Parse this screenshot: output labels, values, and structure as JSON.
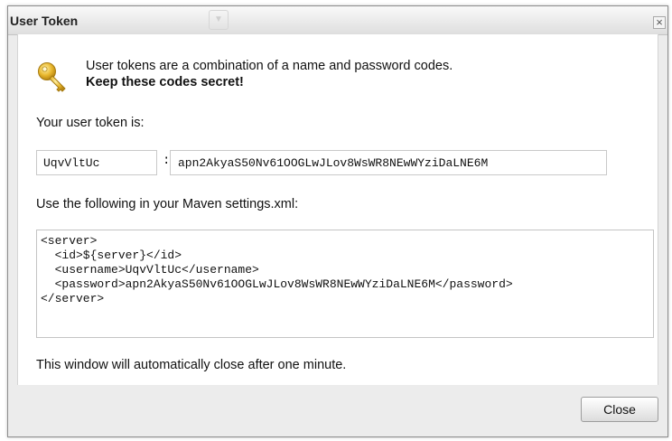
{
  "window": {
    "title": "User Token"
  },
  "intro": {
    "line1": "User tokens are a combination of a name and password codes.",
    "line2": "Keep these codes secret!"
  },
  "token_label": "Your user token is:",
  "token": {
    "name": "UqvVltUc",
    "separator": ":",
    "password": "apn2AkyaS50Nv61OOGLwJLov8WsWR8NEwWYziDaLNE6M"
  },
  "maven_label": "Use the following in your Maven settings.xml:",
  "xml_lines": [
    "<server>",
    "  <id>${server}</id>",
    "  <username>UqvVltUc</username>",
    "  <password>apn2AkyaS50Nv61OOGLwJLov8WsWR8NEwWYziDaLNE6M</password>",
    "</server>"
  ],
  "auto_close_text": "This window will automatically close after one minute.",
  "footer": {
    "close_label": "Close"
  },
  "icons": {
    "title_close": "close-icon",
    "key": "key-icon"
  },
  "colors": {
    "key_gold": "#e2b32a",
    "panel_gray": "#ececec"
  }
}
